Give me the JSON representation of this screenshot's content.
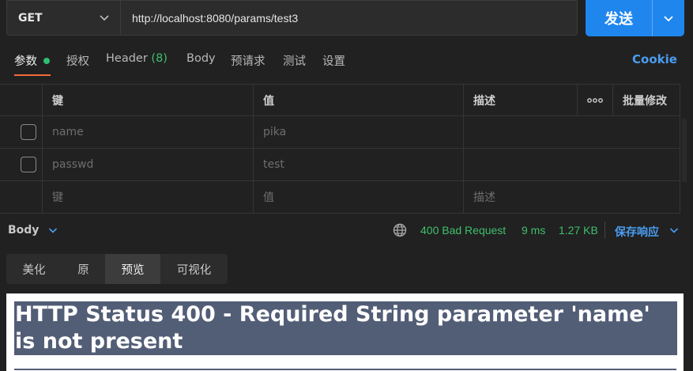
{
  "request": {
    "method": "GET",
    "url": "http://localhost:8080/params/test3",
    "send_label": "发送"
  },
  "tabs": {
    "params": "参数",
    "auth": "授权",
    "header": "Header",
    "header_count": "(8)",
    "body": "Body",
    "prerequest": "预请求",
    "tests": "测试",
    "settings": "设置",
    "cookie": "Cookie"
  },
  "params_table": {
    "headers": {
      "key": "键",
      "value": "值",
      "description": "描述",
      "more": "ooo",
      "bulk_edit": "批量修改"
    },
    "rows": [
      {
        "key": "name",
        "value": "pika",
        "description": ""
      },
      {
        "key": "passwd",
        "value": "test",
        "description": ""
      }
    ],
    "empty_row": {
      "key": "键",
      "value": "值",
      "description": "描述"
    }
  },
  "response": {
    "body_label": "Body",
    "status": "400 Bad Request",
    "time": "9 ms",
    "size": "1.27 KB",
    "save_label": "保存响应",
    "view_tabs": [
      "美化",
      "原",
      "预览",
      "可视化"
    ],
    "active_view": "预览",
    "preview_heading": "HTTP Status 400 - Required String parameter 'name' is not present"
  },
  "colors": {
    "accent": "#1f86ed",
    "success": "#3fbf6c",
    "link": "#4a9df0",
    "tab_underline": "#f26b3a",
    "preview_heading_bg": "#525d76"
  }
}
